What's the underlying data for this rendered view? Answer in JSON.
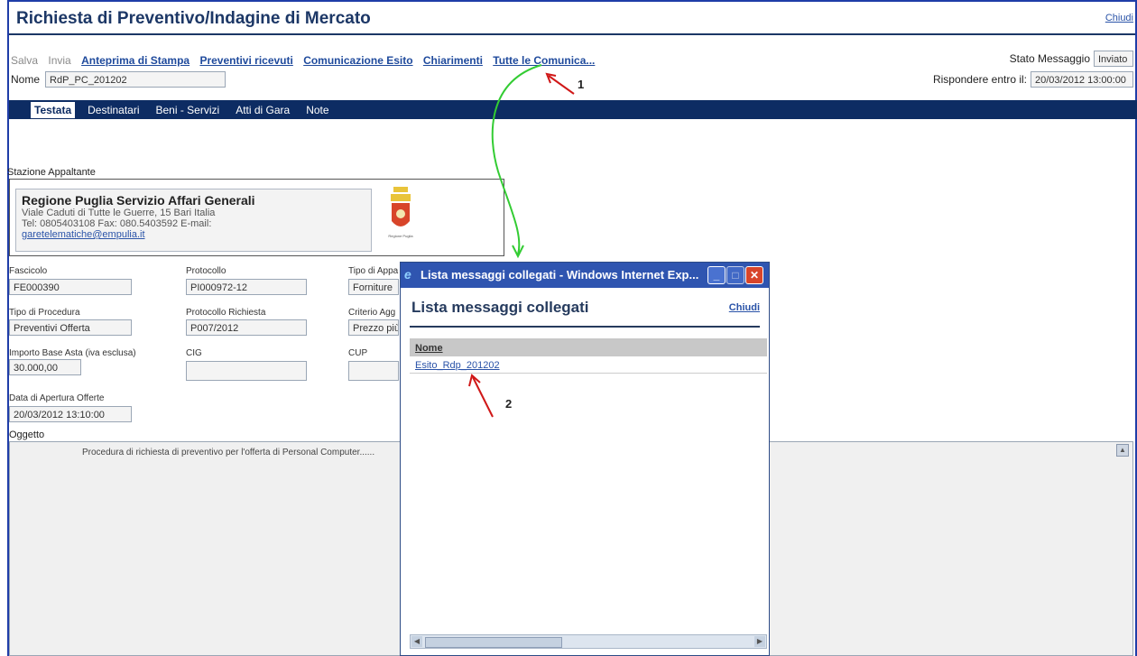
{
  "header": {
    "title": "Richiesta di Preventivo/Indagine di Mercato",
    "close_label": "Chiudi"
  },
  "toolbar": {
    "save": "Salva",
    "send": "Invia",
    "links": [
      "Anteprima di Stampa",
      "Preventivi ricevuti",
      "Comunicazione Esito",
      "Chiarimenti",
      "Tutte le Comunica..."
    ]
  },
  "name_field": {
    "label": "Nome",
    "value": "RdP_PC_201202"
  },
  "status": {
    "label": "Stato Messaggio",
    "value": "Inviato"
  },
  "deadline": {
    "label": "Rispondere entro il:",
    "value": "20/03/2012 13:00:00"
  },
  "tabs": [
    "Testata",
    "Destinatari",
    "Beni - Servizi",
    "Atti di Gara",
    "Note"
  ],
  "stazione": {
    "label": "Stazione Appaltante",
    "name": "Regione Puglia Servizio Affari Generali",
    "address": "Viale Caduti di Tutte le Guerre, 15 Bari Italia",
    "contacts": "Tel: 0805403108 Fax: 080.5403592 E-mail:",
    "email": "garetelematiche@empulia.it",
    "logo_text": "Regione Puglia"
  },
  "fields": {
    "fascicolo": {
      "label": "Fascicolo",
      "value": "FE000390"
    },
    "protocollo": {
      "label": "Protocollo",
      "value": "PI000972-12"
    },
    "tipo_appalto": {
      "label": "Tipo di Appa",
      "value": "Forniture"
    },
    "tipo_procedura": {
      "label": "Tipo di Procedura",
      "value": "Preventivi Offerta"
    },
    "protocollo_richiesta": {
      "label": "Protocollo Richiesta",
      "value": "P007/2012"
    },
    "criterio": {
      "label": "Criterio Agg",
      "value": "Prezzo più"
    },
    "importo": {
      "label": "Importo Base Asta (iva esclusa)",
      "value": "30.000,00"
    },
    "cig": {
      "label": "CIG",
      "value": ""
    },
    "cup": {
      "label": "CUP",
      "value": ""
    },
    "data_apertura": {
      "label": "Data di Apertura Offerte",
      "value": "20/03/2012 13:10:00"
    }
  },
  "oggetto": {
    "label": "Oggetto",
    "text": "Procedura di richiesta di preventivo per l'offerta di Personal Computer......"
  },
  "popup": {
    "window_title": "Lista messaggi collegati - Windows Internet Exp...",
    "heading": "Lista messaggi collegati",
    "close_label": "Chiudi",
    "column_header": "Nome",
    "rows": [
      "Esito_Rdp_201202"
    ]
  },
  "annotations": {
    "one": "1",
    "two": "2"
  },
  "colors": {
    "brand_navy": "#0d2c63",
    "link_blue": "#1f4a9c",
    "arrow_red": "#d01818",
    "arrow_green": "#33cc33"
  }
}
